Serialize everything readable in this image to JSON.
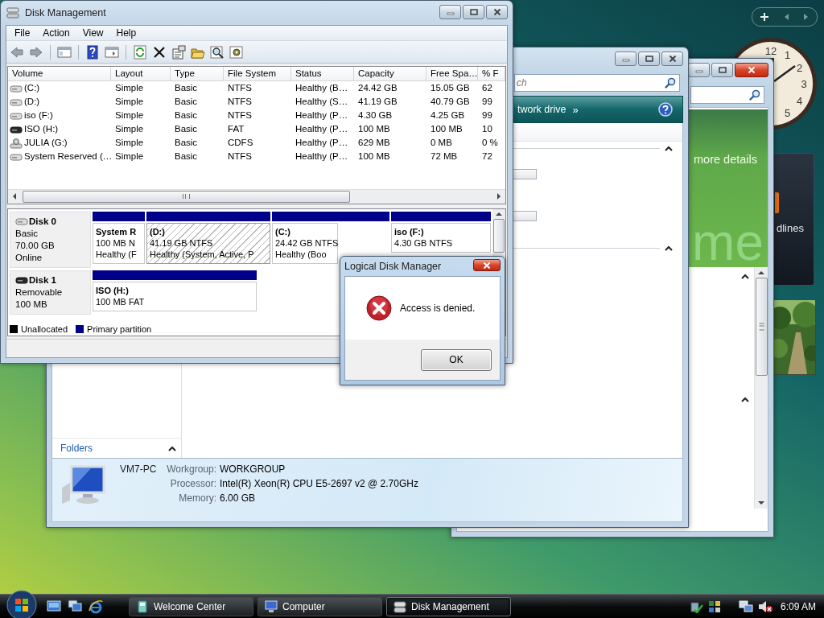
{
  "disk_management": {
    "title": "Disk Management",
    "close_highlighted": false,
    "menu": [
      "File",
      "Action",
      "View",
      "Help"
    ],
    "columns": [
      "Volume",
      "Layout",
      "Type",
      "File System",
      "Status",
      "Capacity",
      "Free Spa…",
      "% F"
    ],
    "volumes": [
      {
        "kind": "hdd",
        "cells": [
          "(C:)",
          "Simple",
          "Basic",
          "NTFS",
          "Healthy (B…",
          "24.42 GB",
          "15.05 GB",
          "62"
        ]
      },
      {
        "kind": "hdd",
        "cells": [
          "(D:)",
          "Simple",
          "Basic",
          "NTFS",
          "Healthy (S…",
          "41.19 GB",
          "40.79 GB",
          "99"
        ]
      },
      {
        "kind": "hdd",
        "cells": [
          "iso (F:)",
          "Simple",
          "Basic",
          "NTFS",
          "Healthy (P…",
          "4.30 GB",
          "4.25 GB",
          "99"
        ]
      },
      {
        "kind": "removable",
        "cells": [
          "ISO (H:)",
          "Simple",
          "Basic",
          "FAT",
          "Healthy (P…",
          "100 MB",
          "100 MB",
          "10"
        ]
      },
      {
        "kind": "cdrom",
        "cells": [
          "JULIA (G:)",
          "Simple",
          "Basic",
          "CDFS",
          "Healthy (P…",
          "629 MB",
          "0 MB",
          "0 %"
        ]
      },
      {
        "kind": "hdd",
        "cells": [
          "System Reserved (…",
          "Simple",
          "Basic",
          "NTFS",
          "Healthy (P…",
          "100 MB",
          "72 MB",
          "72"
        ]
      }
    ],
    "disks": [
      {
        "kind": "hdd",
        "name": "Disk 0",
        "lines": [
          "Basic",
          "70.00 GB",
          "Online"
        ],
        "partitions": [
          {
            "name": "System R",
            "lines": [
              "100 MB N",
              "Healthy (F"
            ],
            "selected": false
          },
          {
            "name": "(D:)",
            "lines": [
              "41.19 GB NTFS",
              "Healthy (System, Active, P"
            ],
            "selected": true
          },
          {
            "name": "(C:)",
            "lines": [
              "24.42 GB NTFS",
              "Healthy (Boo"
            ],
            "selected": false
          },
          {
            "name": "iso  (F:)",
            "lines": [
              "4.30 GB NTFS"
            ],
            "selected": false
          }
        ]
      },
      {
        "kind": "removable",
        "name": "Disk 1",
        "lines": [
          "Removable",
          "100 MB"
        ],
        "partitions": [
          {
            "name": "ISO  (H:)",
            "lines": [
              "100 MB FAT"
            ],
            "selected": false
          }
        ]
      }
    ],
    "legend": [
      {
        "label": "Unallocated",
        "color": "#000000"
      },
      {
        "label": "Primary partition",
        "color": "#00008b"
      }
    ]
  },
  "dialog": {
    "title": "Logical Disk Manager",
    "close_highlighted": true,
    "message": "Access is denied.",
    "button": "OK"
  },
  "computer_window": {
    "close_highlighted": false,
    "search": {
      "placeholder": "ch"
    },
    "toolbar_item": "twork drive",
    "more": "»",
    "nav_header": "Folders",
    "details": {
      "name": "VM7-PC",
      "fields": [
        {
          "label": "Workgroup:",
          "value": "WORKGROUP"
        },
        {
          "label": "Processor:",
          "value": "Intel(R) Xeon(R) CPU E5-2697 v2 @ 2.70GHz"
        },
        {
          "label": "Memory:",
          "value": "6.00 GB"
        }
      ]
    }
  },
  "welcome_window": {
    "close_highlighted": true,
    "banner_link": "more details",
    "banner_title": "me"
  },
  "gadgets": {
    "clock": {
      "numerals": [
        "12",
        "1",
        "2",
        "3",
        "4",
        "5"
      ]
    },
    "headlines": "dlines"
  },
  "taskbar": {
    "tasks": [
      {
        "kind": "welcome",
        "label": "Welcome Center",
        "selected": false
      },
      {
        "kind": "computer",
        "label": "Computer",
        "selected": false
      },
      {
        "kind": "disk",
        "label": "Disk Management",
        "selected": true
      }
    ],
    "time": "6:09 AM"
  }
}
